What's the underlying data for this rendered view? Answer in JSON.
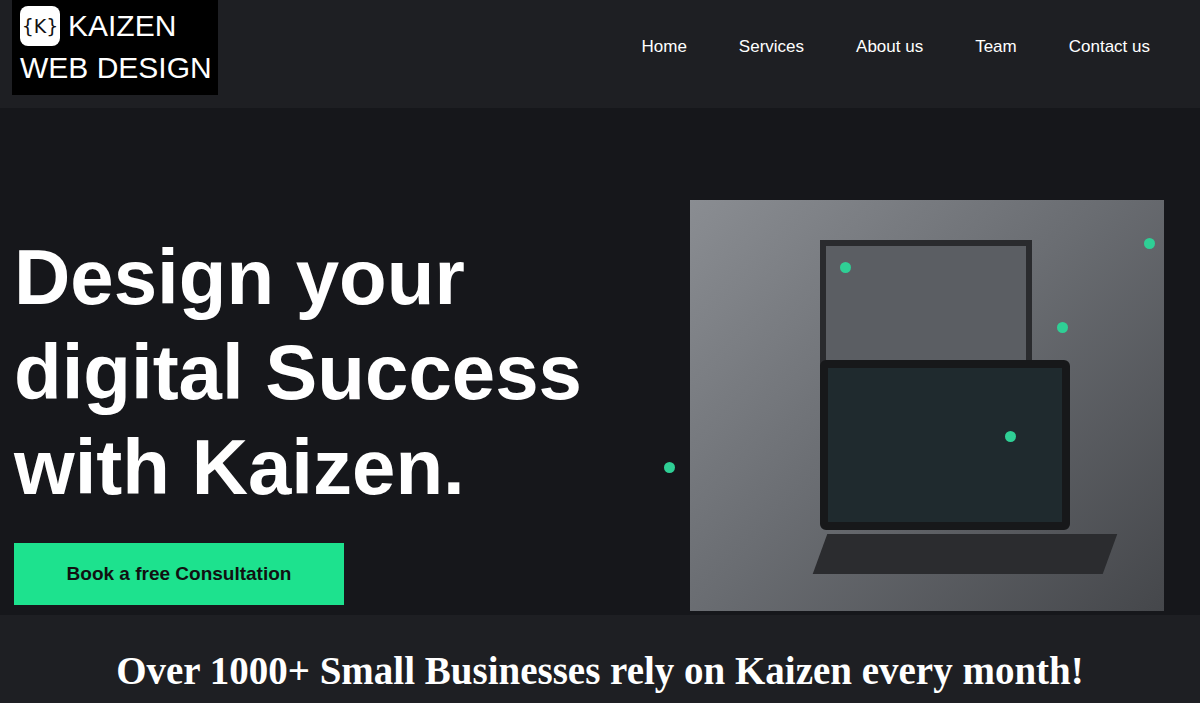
{
  "logo": {
    "icon": "{K}",
    "line1": "KAIZEN",
    "line2": "WEB DESIGN"
  },
  "nav": {
    "items": [
      {
        "label": "Home"
      },
      {
        "label": "Services"
      },
      {
        "label": "About us"
      },
      {
        "label": "Team"
      },
      {
        "label": "Contact us"
      }
    ]
  },
  "hero": {
    "heading_lines": [
      "Design your",
      "digital Success",
      "with Kaizen."
    ],
    "button": "Book a free Consultation"
  },
  "banner": {
    "text": "Over 1000+ Small Businesses rely on Kaizen every month!"
  }
}
